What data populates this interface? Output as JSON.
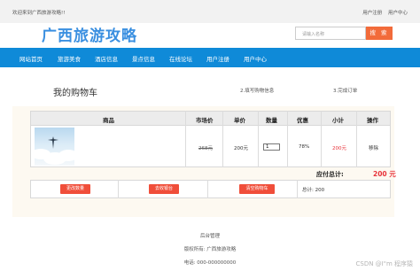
{
  "topbar": {
    "welcome": "欢迎来到广西旅游攻略!!",
    "register": "用户注册",
    "user_center": "用户中心"
  },
  "header": {
    "logo": "广西旅游攻略",
    "search_placeholder": "请输入名称",
    "search_button": "搜 索"
  },
  "nav": [
    "网站首页",
    "旅游美食",
    "酒店信息",
    "景点信息",
    "在线论坛",
    "用户注册",
    "用户中心"
  ],
  "cart": {
    "title": "我的购物车",
    "steps": [
      "2.填写购物信息",
      "3.完成订单"
    ],
    "headers": [
      "商品",
      "市场价",
      "单价",
      "数量",
      "优惠",
      "小计",
      "操作"
    ],
    "item": {
      "market_price": "268元",
      "price": "200元",
      "quantity": "1",
      "discount": "78%",
      "subtotal": "200元",
      "remove": "移除"
    },
    "total_label": "应付总计:",
    "total_value": "200 元",
    "buttons": [
      "更改数量",
      "去收银台",
      "清空购物车"
    ],
    "count_text": "总计: 200"
  },
  "footer": {
    "admin": "后台管理",
    "copyright": "版权所有: 广西旅游攻略",
    "phone": "电话: 000-000000000"
  },
  "watermark": "CSDN @I\"m 程序猿"
}
